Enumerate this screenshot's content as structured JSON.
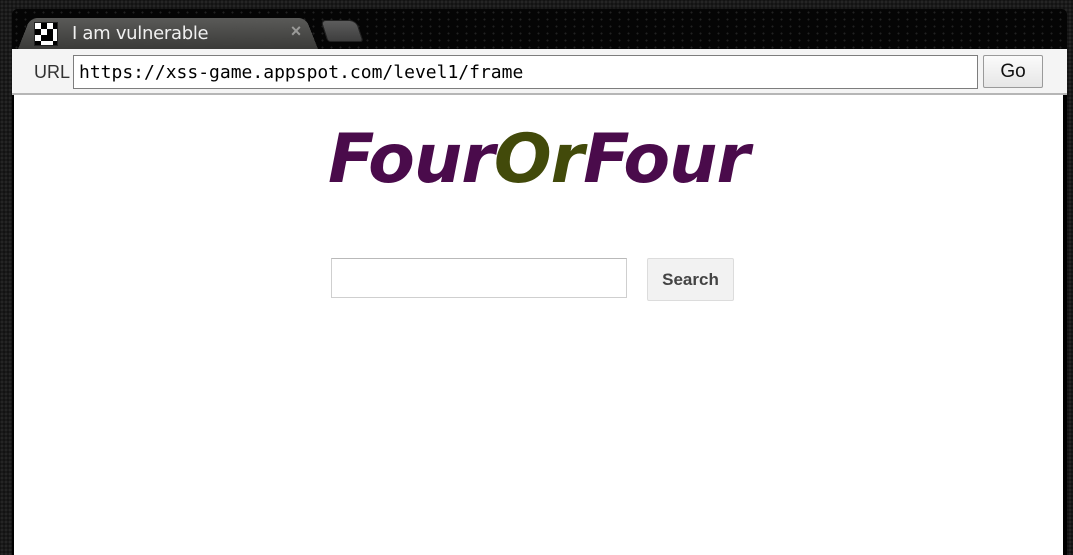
{
  "tab": {
    "title": "I am vulnerable",
    "close_glyph": "×",
    "favicon_icon": "checkerboard-icon"
  },
  "toolbar": {
    "url_label": "URL",
    "url_value": "https://xss-game.appspot.com/level1/frame",
    "go_label": "Go"
  },
  "page": {
    "logo_part1": "Four",
    "logo_part2": "Or",
    "logo_part3": "Four",
    "search_value": "",
    "search_button_label": "Search"
  },
  "colors": {
    "logo_purple": "#4a0b4b",
    "logo_olive": "#424a0a"
  }
}
